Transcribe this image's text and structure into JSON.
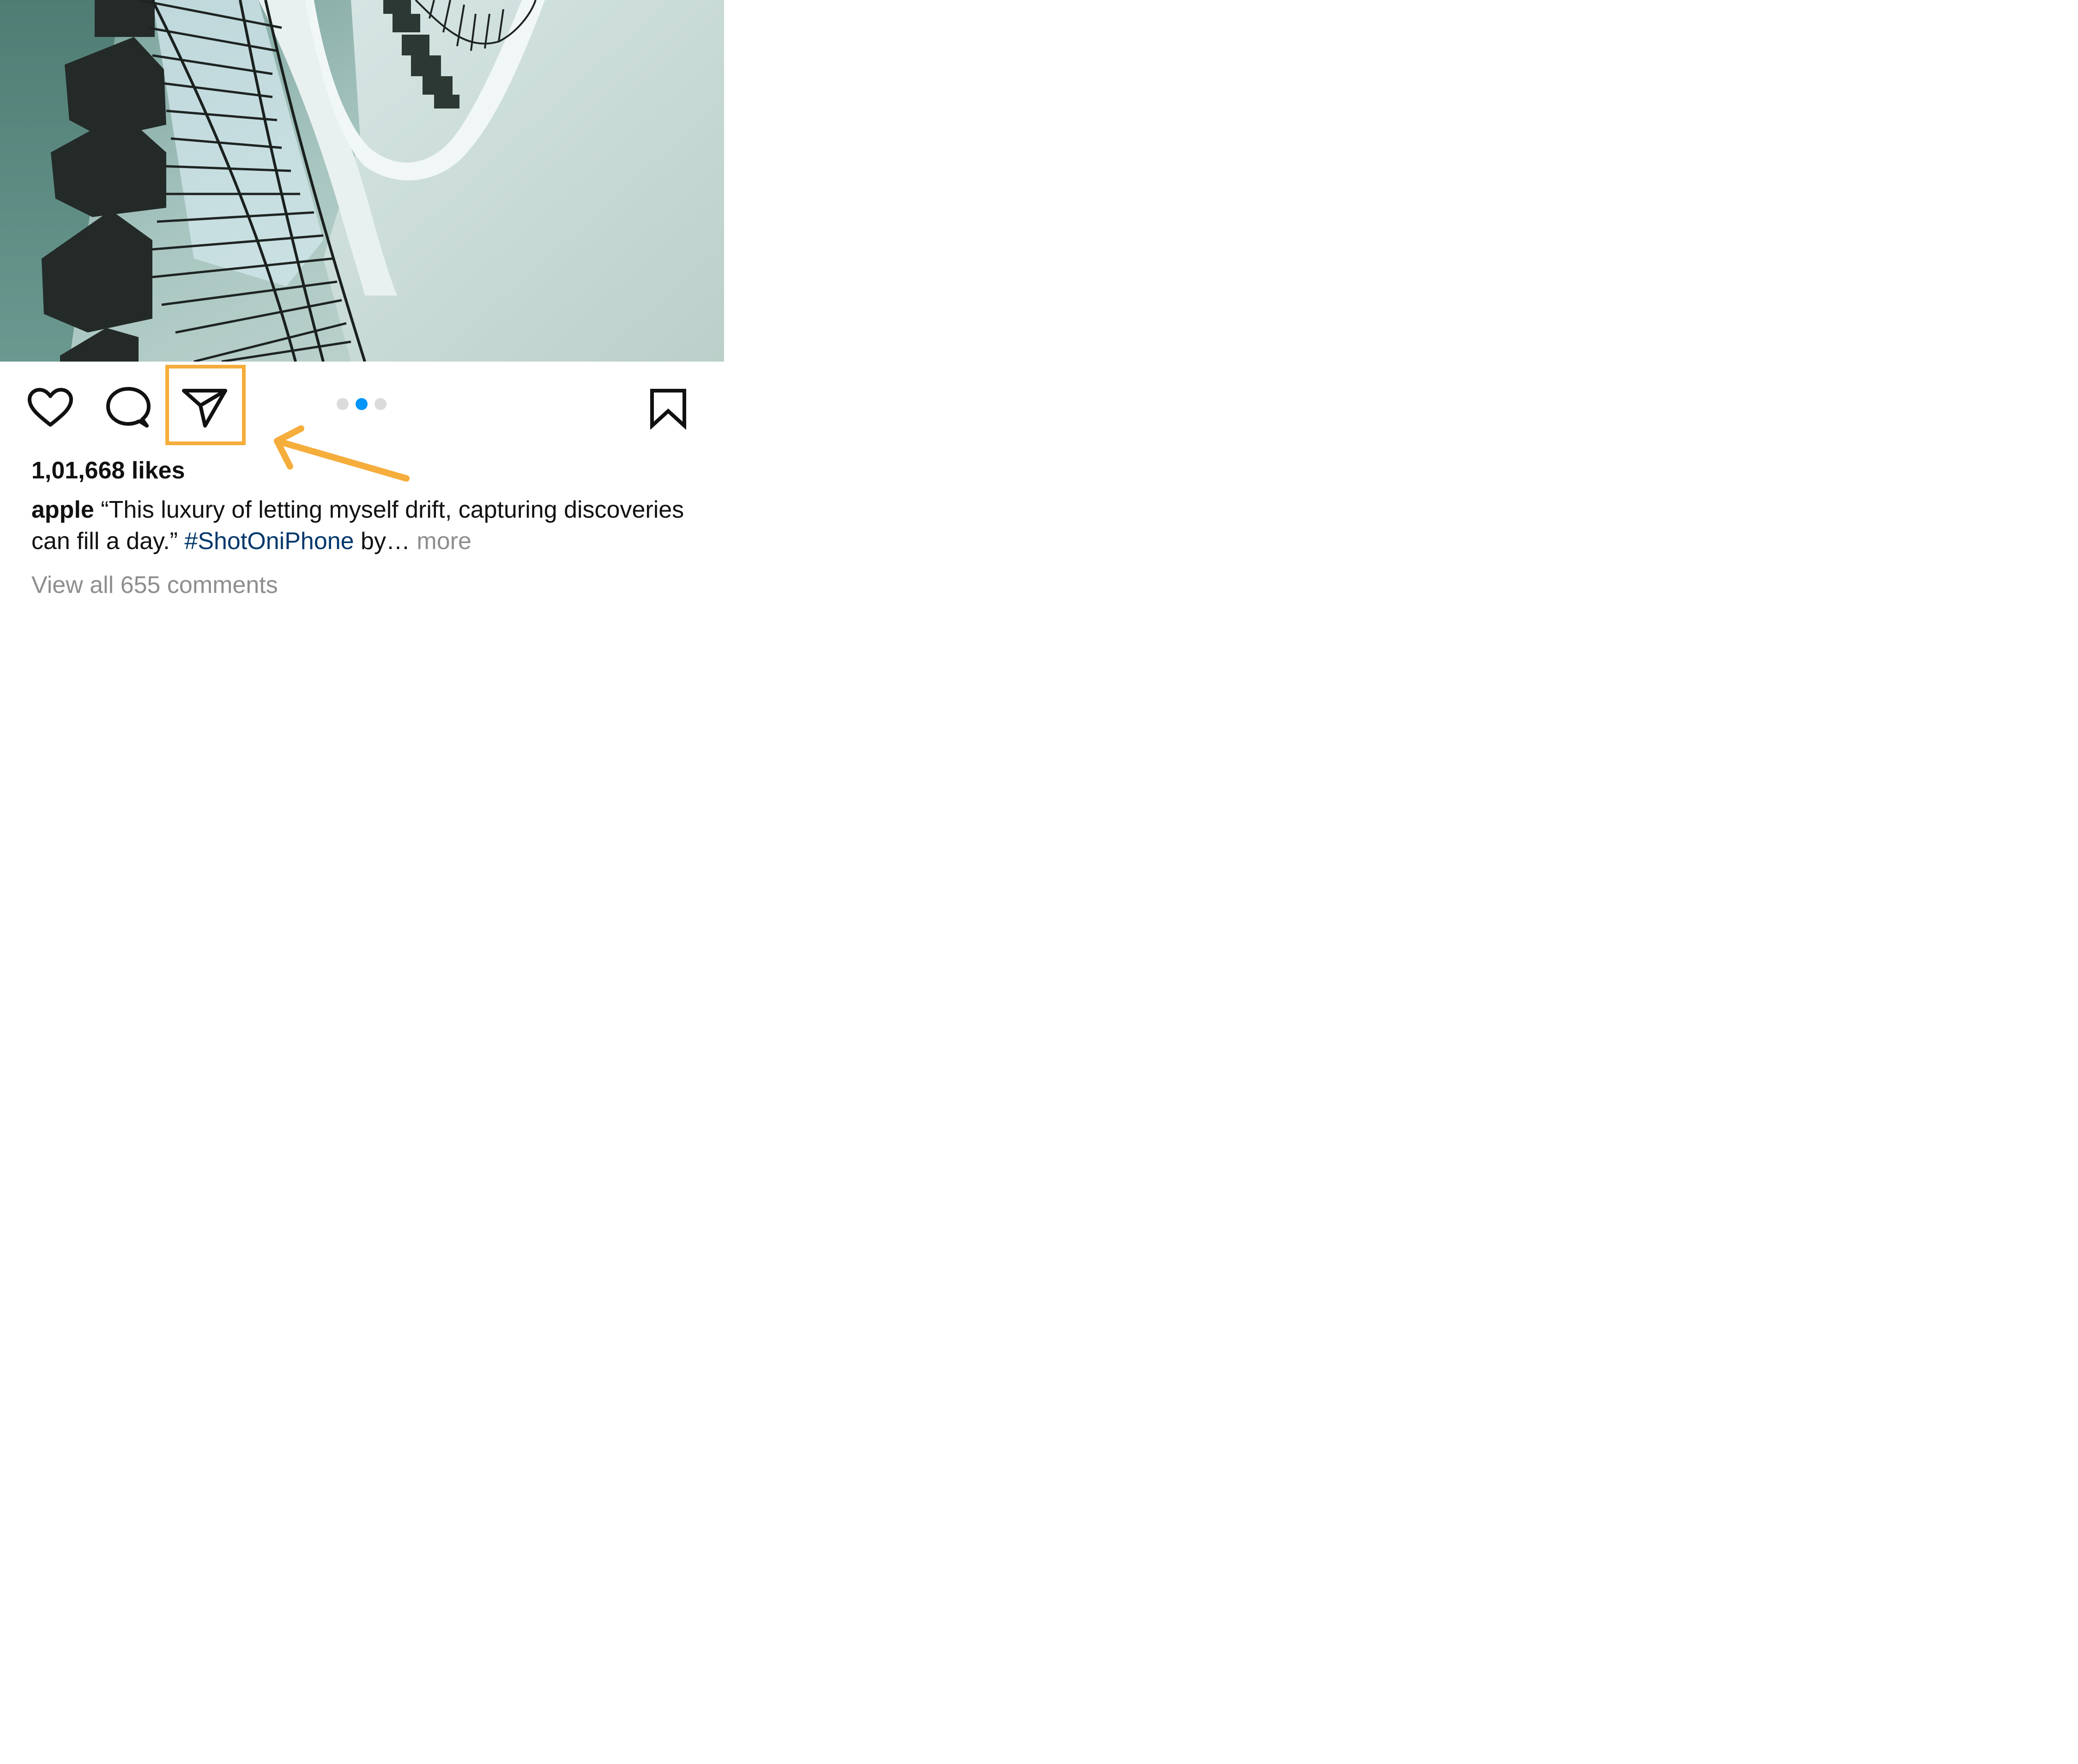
{
  "post": {
    "photo_alt": "",
    "likes": "1,01,668 likes",
    "caption": {
      "username": "apple",
      "text": " “This luxury of letting myself drift, capturing discoveries can fill a day.” ",
      "hashtag": "#ShotOniPhone",
      "tail": " by…",
      "more_label": " more"
    },
    "view_comments": "View all 655 comments",
    "carousel": {
      "count": 3,
      "active_index": 1
    }
  },
  "icons": {
    "like": "heart-icon",
    "comment": "comment-bubble-icon",
    "share": "paper-plane-icon",
    "save": "bookmark-icon"
  },
  "colors": {
    "active_dot": "#0095f6",
    "inactive_dot": "#dbdbdb",
    "hashtag": "#00376b",
    "muted_text": "#8e8e8e",
    "annotation": "#f5ad3b"
  }
}
